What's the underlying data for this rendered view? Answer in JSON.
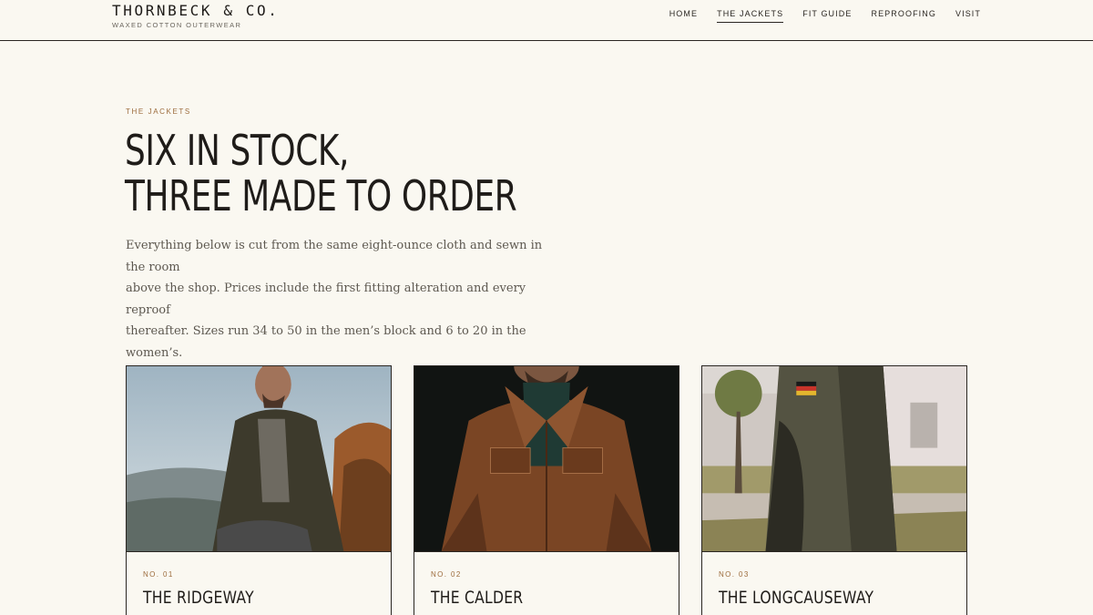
{
  "brand": {
    "name": "THORNBECK & CO.",
    "tagline": "WAXED COTTON OUTERWEAR"
  },
  "nav": {
    "items": [
      {
        "label": "HOME",
        "active": false
      },
      {
        "label": "THE JACKETS",
        "active": true
      },
      {
        "label": "FIT GUIDE",
        "active": false
      },
      {
        "label": "REPROOFING",
        "active": false
      },
      {
        "label": "VISIT",
        "active": false
      }
    ]
  },
  "hero": {
    "eyebrow": "THE JACKETS",
    "headline_line1": "SIX IN STOCK,",
    "headline_line2": "THREE MADE TO ORDER",
    "lede_line1": "Everything below is cut from the same eight-ounce cloth and sewn in the room",
    "lede_line2": "above the shop. Prices include the first fitting alteration and every reproof",
    "lede_line3": "thereafter. Sizes run 34 to 50 in the men’s block and 6 to 20 in the women’s."
  },
  "products": [
    {
      "number": "NO. 01",
      "name": "THE RIDGEWAY"
    },
    {
      "number": "NO. 02",
      "name": "THE CALDER"
    },
    {
      "number": "NO. 03",
      "name": "THE LONGCAUSEWAY"
    }
  ],
  "colors": {
    "background": "#faf8f1",
    "ink": "#1f1c19",
    "accent": "#9c6b3c"
  }
}
